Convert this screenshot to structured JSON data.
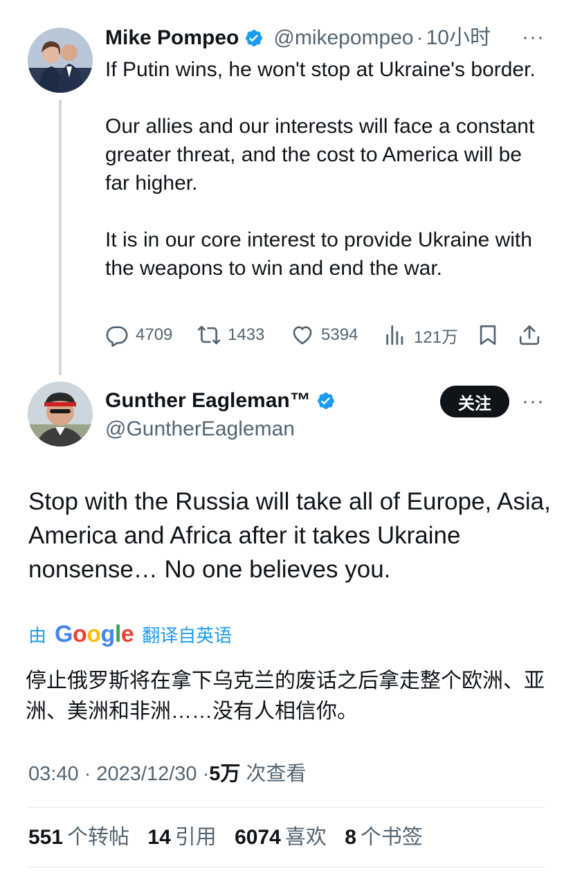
{
  "tweet1": {
    "author_name": "Mike Pompeo",
    "handle": "@mikepompeo",
    "separator": "·",
    "time": "10小时",
    "more": "···",
    "paragraphs": [
      "If Putin wins, he won't stop at Ukraine's border.",
      "Our allies and our interests will face a constant greater threat, and the cost to America will be far higher.",
      "It is in our core interest to provide Ukraine with the weapons to win and end the war."
    ],
    "actions": {
      "replies": "4709",
      "retweets": "1433",
      "likes": "5394",
      "views": "121万"
    }
  },
  "tweet2": {
    "author_name": "Gunther Eagleman™",
    "handle": "@GuntherEagleman",
    "follow_label": "关注",
    "more": "···",
    "text": "Stop with the Russia will take all of Europe, Asia, America and Africa after it takes Ukraine nonsense…    No one believes you.",
    "translate": {
      "prefix": "由",
      "provider": "Google",
      "suffix": "翻译自英语"
    },
    "translated_text": "停止俄罗斯将在拿下乌克兰的废话之后拿走整个欧洲、亚洲、美洲和非洲……没有人相信你。",
    "meta": {
      "time": "03:40",
      "sep1": "·",
      "date": "2023/12/30",
      "sep2": "·",
      "views_count": "5万",
      "views_label": "次查看"
    },
    "stats": [
      {
        "count": "551",
        "label": "个转帖"
      },
      {
        "count": "14",
        "label": "引用"
      },
      {
        "count": "6074",
        "label": "喜欢"
      },
      {
        "count": "8",
        "label": "个书签"
      }
    ]
  },
  "colors": {
    "accent": "#1d9bf0",
    "text_primary": "#0f1419",
    "text_secondary": "#536471",
    "divider": "#e1e8ed"
  },
  "icons": [
    "verified-badge-icon",
    "reply-icon",
    "retweet-icon",
    "like-icon",
    "views-icon",
    "bookmark-icon",
    "share-icon",
    "more-icon"
  ]
}
